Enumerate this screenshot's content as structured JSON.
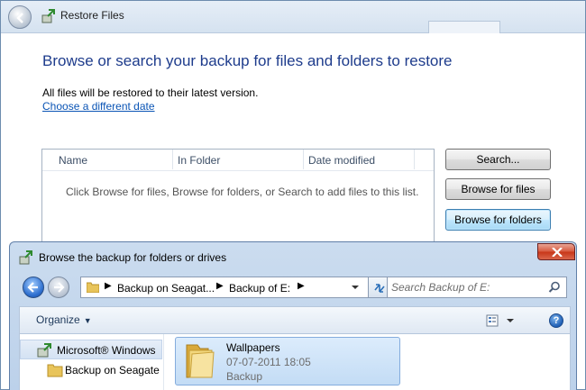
{
  "restore_window": {
    "title": "Restore Files",
    "heading": "Browse or search your backup for files and folders to restore",
    "info_text": "All files will be restored to their latest version.",
    "choose_date_link": "Choose a different date",
    "columns": [
      "Name",
      "In Folder",
      "Date modified"
    ],
    "empty_message": "Click Browse for files, Browse for folders, or Search to add files to this list.",
    "buttons": {
      "search": "Search...",
      "browse_files": "Browse for files",
      "browse_folders": "Browse for folders"
    }
  },
  "browse_dialog": {
    "title": "Browse the backup for folders or drives",
    "address": {
      "crumbs": [
        "Backup on Seagat...",
        "Backup of E:"
      ]
    },
    "search_placeholder": "Search Backup of E:",
    "toolbar": {
      "organize_label": "Organize"
    },
    "help_label": "?",
    "tree": [
      {
        "label": "Microsoft® Windows",
        "icon": "backup-icon",
        "selected": true
      },
      {
        "label": "Backup on Seagate",
        "icon": "folder-icon",
        "selected": false
      }
    ],
    "items": [
      {
        "name": "Wallpapers",
        "date": "07-07-2011 18:05",
        "type": "Backup",
        "icon": "folder-icon"
      }
    ]
  },
  "colors": {
    "heading": "#1e3c8c",
    "link": "#0a54b5",
    "close_button": "#c73518"
  }
}
